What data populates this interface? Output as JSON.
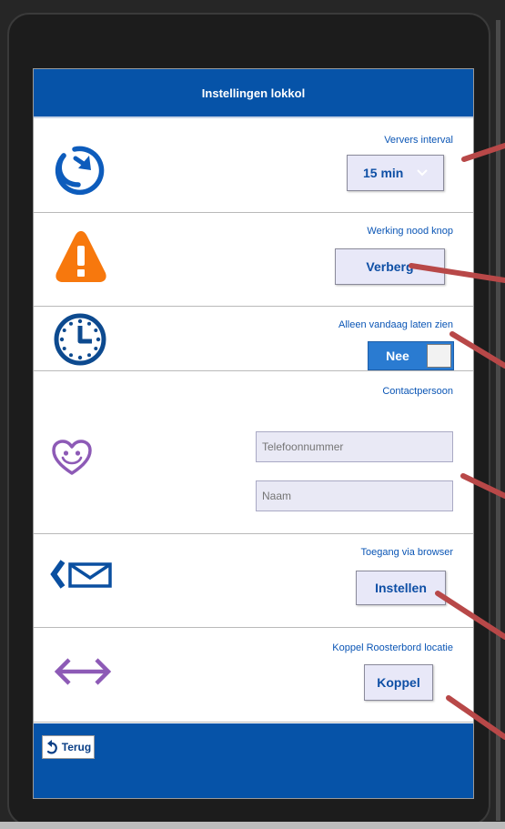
{
  "header": {
    "title": "Instellingen lokkol"
  },
  "rows": [
    {
      "label": "Ververs interval",
      "icon": "refresh-icon",
      "control": {
        "type": "select",
        "value": "15 min"
      }
    },
    {
      "label": "Werking nood knop",
      "icon": "warning-icon",
      "control": {
        "type": "button",
        "label": "Verberg"
      }
    },
    {
      "label": "Alleen vandaag laten zien",
      "icon": "clock-icon",
      "control": {
        "type": "toggle",
        "value": "Nee"
      }
    },
    {
      "label": "Contactpersoon",
      "icon": "smiley-heart-icon",
      "control": {
        "type": "inputs",
        "phone_placeholder": "Telefoonnummer",
        "name_placeholder": "Naam"
      }
    },
    {
      "label": "Toegang via browser",
      "icon": "mail-back-icon",
      "control": {
        "type": "button",
        "label": "Instellen"
      }
    },
    {
      "label": "Koppel Roosterbord locatie",
      "icon": "double-arrow-icon",
      "control": {
        "type": "button",
        "label": "Koppel"
      }
    }
  ],
  "footer": {
    "back_label": "Terug",
    "back_icon": "undo-arrow-icon"
  },
  "colors": {
    "header_blue": "#0653a8",
    "label_blue": "#0a55b5",
    "toggle_blue": "#2a7bd1",
    "warning_orange": "#f7780d",
    "purple": "#8d5ab6",
    "annotation_red": "#b84848"
  }
}
